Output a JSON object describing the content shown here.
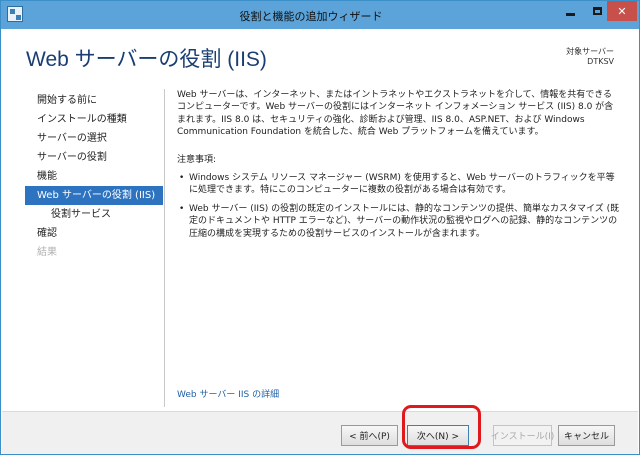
{
  "window": {
    "title": "役割と機能の追加ウィザード",
    "icons": {
      "app": "wizard-icon",
      "minimize": "minimize-icon",
      "maximize": "maximize-icon",
      "close": "close-icon"
    },
    "close_label": "✕"
  },
  "header": {
    "title": "Web サーバーの役割 (IIS)",
    "target_label": "対象サーバー",
    "target_name": "DTKSV"
  },
  "nav": {
    "items": [
      {
        "label": "開始する前に",
        "state": "normal"
      },
      {
        "label": "インストールの種類",
        "state": "normal"
      },
      {
        "label": "サーバーの選択",
        "state": "normal"
      },
      {
        "label": "サーバーの役割",
        "state": "normal"
      },
      {
        "label": "機能",
        "state": "normal"
      },
      {
        "label": "Web サーバーの役割 (IIS)",
        "state": "active"
      },
      {
        "label": "役割サービス",
        "state": "sub"
      },
      {
        "label": "確認",
        "state": "normal"
      },
      {
        "label": "結果",
        "state": "disabled"
      }
    ]
  },
  "content": {
    "intro": "Web サーバーは、インターネット、またはイントラネットやエクストラネットを介して、情報を共有できるコンピューターです。Web サーバーの役割にはインターネット インフォメーション サービス (IIS) 8.0 が含まれます。IIS 8.0 は、セキュリティの強化、診断および管理、IIS 8.0、ASP.NET、および Windows Communication Foundation を統合した、統合 Web プラットフォームを備えています。",
    "notes_heading": "注意事項:",
    "notes": [
      "Windows システム リソース マネージャー (WSRM) を使用すると、Web サーバーのトラフィックを平等に処理できます。特にこのコンピューターに複数の役割がある場合は有効です。",
      "Web サーバー (IIS) の役割の既定のインストールには、静的なコンテンツの提供、簡単なカスタマイズ (既定のドキュメントや HTTP エラーなど)、サーバーの動作状況の監視やログへの記録、静的なコンテンツの圧縮の構成を実現するための役割サービスのインストールが含まれます。"
    ],
    "more_link": "Web サーバー IIS の詳細"
  },
  "footer": {
    "prev_label": "< 前へ(P)",
    "next_label": "次へ(N) >",
    "install_label": "インストール(I)",
    "cancel_label": "キャンセル"
  },
  "colors": {
    "titlebar": "#5ba3d9",
    "accent": "#2e73c0",
    "title_text": "#1a3e72",
    "highlight": "#e0191f"
  }
}
